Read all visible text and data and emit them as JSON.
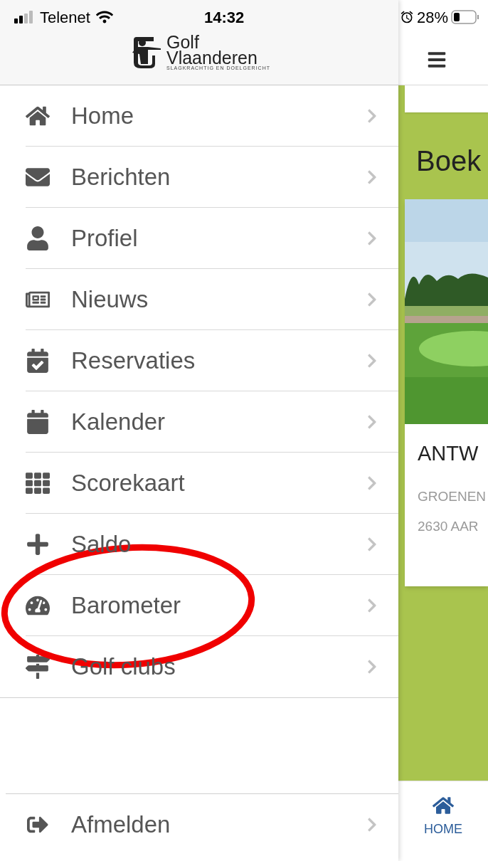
{
  "status_bar": {
    "carrier": "Telenet",
    "time": "14:32",
    "battery": "28%"
  },
  "logo": {
    "line_1": "Golf",
    "line_2": "Vlaanderen",
    "tagline": "SLAGKRACHTIG EN DOELGERICHT"
  },
  "menu": {
    "items": [
      {
        "label": "Home",
        "highlighted": false
      },
      {
        "label": "Berichten",
        "highlighted": false
      },
      {
        "label": "Profiel",
        "highlighted": false
      },
      {
        "label": "Nieuws",
        "highlighted": false
      },
      {
        "label": "Reservaties",
        "highlighted": false
      },
      {
        "label": "Kalender",
        "highlighted": false
      },
      {
        "label": "Scorekaart",
        "highlighted": false
      },
      {
        "label": "Saldo",
        "highlighted": false
      },
      {
        "label": "Barometer",
        "highlighted": true
      },
      {
        "label": "Golf clubs",
        "highlighted": false
      }
    ],
    "footer_item": {
      "label": "Afmelden"
    }
  },
  "background_page": {
    "heading": "Boek",
    "card": {
      "title": "ANTW",
      "address_1": "GROENEN",
      "address_2": "2630 AAR"
    },
    "tab_bar": [
      {
        "label": "HOME",
        "selected": true
      }
    ]
  }
}
